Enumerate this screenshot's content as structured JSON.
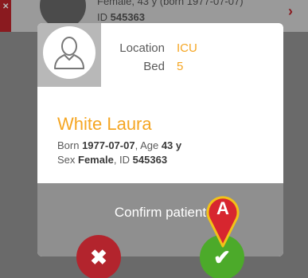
{
  "background_row": {
    "line1": "Female, 43 y (born 1977-07-07)",
    "id_prefix": "ID ",
    "id_value": "545363"
  },
  "dialog": {
    "location_label": "Location",
    "location_value": "ICU",
    "bed_label": "Bed",
    "bed_value": "5",
    "patient_name": "White Laura",
    "born_label": "Born ",
    "born_value": "1977-07-07",
    "age_label": ", Age ",
    "age_value": "43 y",
    "sex_label": "Sex ",
    "sex_value": "Female",
    "id_label": ",  ID ",
    "id_value": "545363",
    "confirm_text": "Confirm patient"
  },
  "buttons": {
    "cancel_icon": "close-icon",
    "confirm_icon": "check-icon"
  },
  "annotation": {
    "letter": "A"
  },
  "colors": {
    "accent_orange": "#f5a623",
    "cancel_red": "#b3242d",
    "confirm_green": "#4caa2a",
    "marker_red": "#d7262f",
    "marker_yellow": "#f2c218"
  }
}
